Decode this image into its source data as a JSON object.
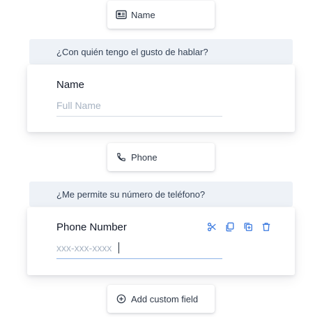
{
  "name_field": {
    "pill_label": "Name",
    "pill_icon": "id-card-icon",
    "question": "¿Con quién tengo el gusto de hablar?",
    "label": "Name",
    "placeholder": "Full Name"
  },
  "phone_field": {
    "pill_label": "Phone",
    "pill_icon": "phone-icon",
    "question": "¿Me permite su número de teléfono?",
    "label": "Phone Number",
    "placeholder": "xxx-xxx-xxxx",
    "tools": [
      "scissors-icon",
      "copy-icon",
      "duplicate-icon",
      "trash-icon"
    ]
  },
  "add_custom": {
    "label": "Add custom field",
    "icon": "plus-circle-icon"
  },
  "colors": {
    "accent": "#3b7ae0",
    "question_bg": "#eef2f7",
    "placeholder": "#a7b3c2"
  }
}
